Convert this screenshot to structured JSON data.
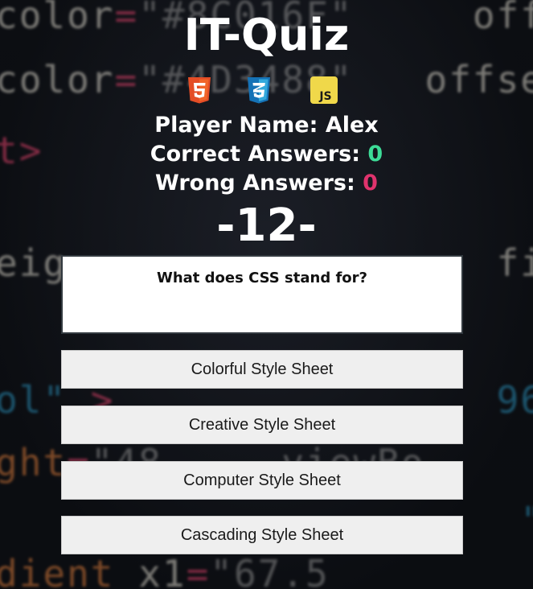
{
  "header": {
    "title": "IT-Quiz",
    "icons": [
      "html5-icon",
      "css3-icon",
      "javascript-icon"
    ],
    "js_label": "JS"
  },
  "stats": {
    "player_label": "Player Name: ",
    "player_name": "Alex",
    "correct_label": "Correct Answers: ",
    "correct_value": "0",
    "wrong_label": "Wrong Answers: ",
    "wrong_value": "0"
  },
  "counter": "-12-",
  "question": {
    "text": "What does CSS stand for?"
  },
  "answers": [
    "Colorful Style Sheet",
    "Creative Style Sheet",
    "Computer Style Sheet",
    "Cascading Style Sheet"
  ],
  "colors": {
    "correct": "#3ddc97",
    "wrong": "#e0336d",
    "html5": "#e44d26",
    "css3": "#2f7bd9",
    "javascript": "#f0d84a"
  }
}
